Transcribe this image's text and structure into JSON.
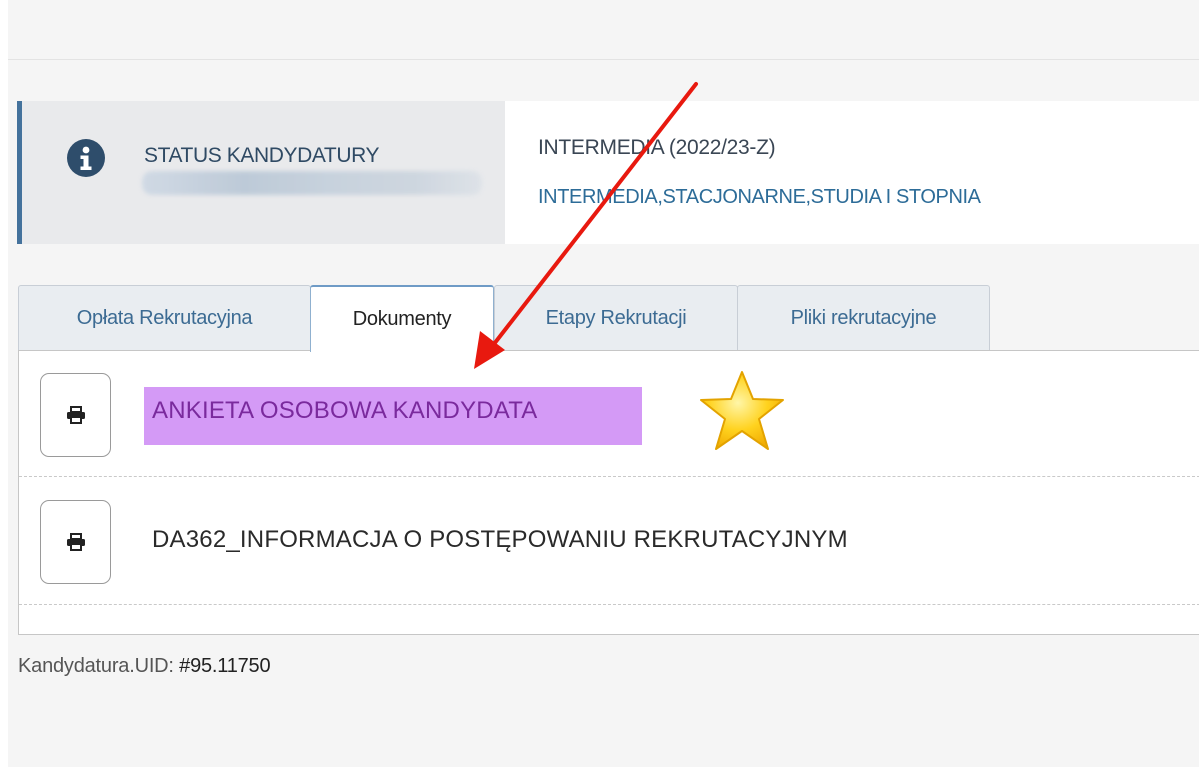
{
  "status": {
    "label": "STATUS KANDYDATURY",
    "value_redacted": true
  },
  "program": {
    "title": "INTERMEDIA (2022/23-Z)",
    "subtitle": "INTERMEDIA,STACJONARNE,STUDIA I STOPNIA"
  },
  "tabs": [
    {
      "label": "Opłata Rekrutacyjna",
      "active": false
    },
    {
      "label": "Dokumenty",
      "active": true
    },
    {
      "label": "Etapy Rekrutacji",
      "active": false
    },
    {
      "label": "Pliki rekrutacyjne",
      "active": false
    }
  ],
  "documents": [
    {
      "label": "ANKIETA OSOBOWA KANDYDATA",
      "highlighted": true,
      "highlight_color": "#d49af6"
    },
    {
      "label": "DA362_INFORMACJA O POSTĘPOWANIU REKRUTACYJNYM",
      "highlighted": false
    }
  ],
  "footer": {
    "label": "Kandydatura.UID:",
    "value": "#95.11750"
  },
  "annotations": {
    "arrow_color": "#e8190f",
    "star_color": "#ffd21e"
  },
  "icons": {
    "info": "info-icon",
    "print": "printer-icon",
    "star": "star-icon",
    "arrow": "arrow-annotation"
  }
}
